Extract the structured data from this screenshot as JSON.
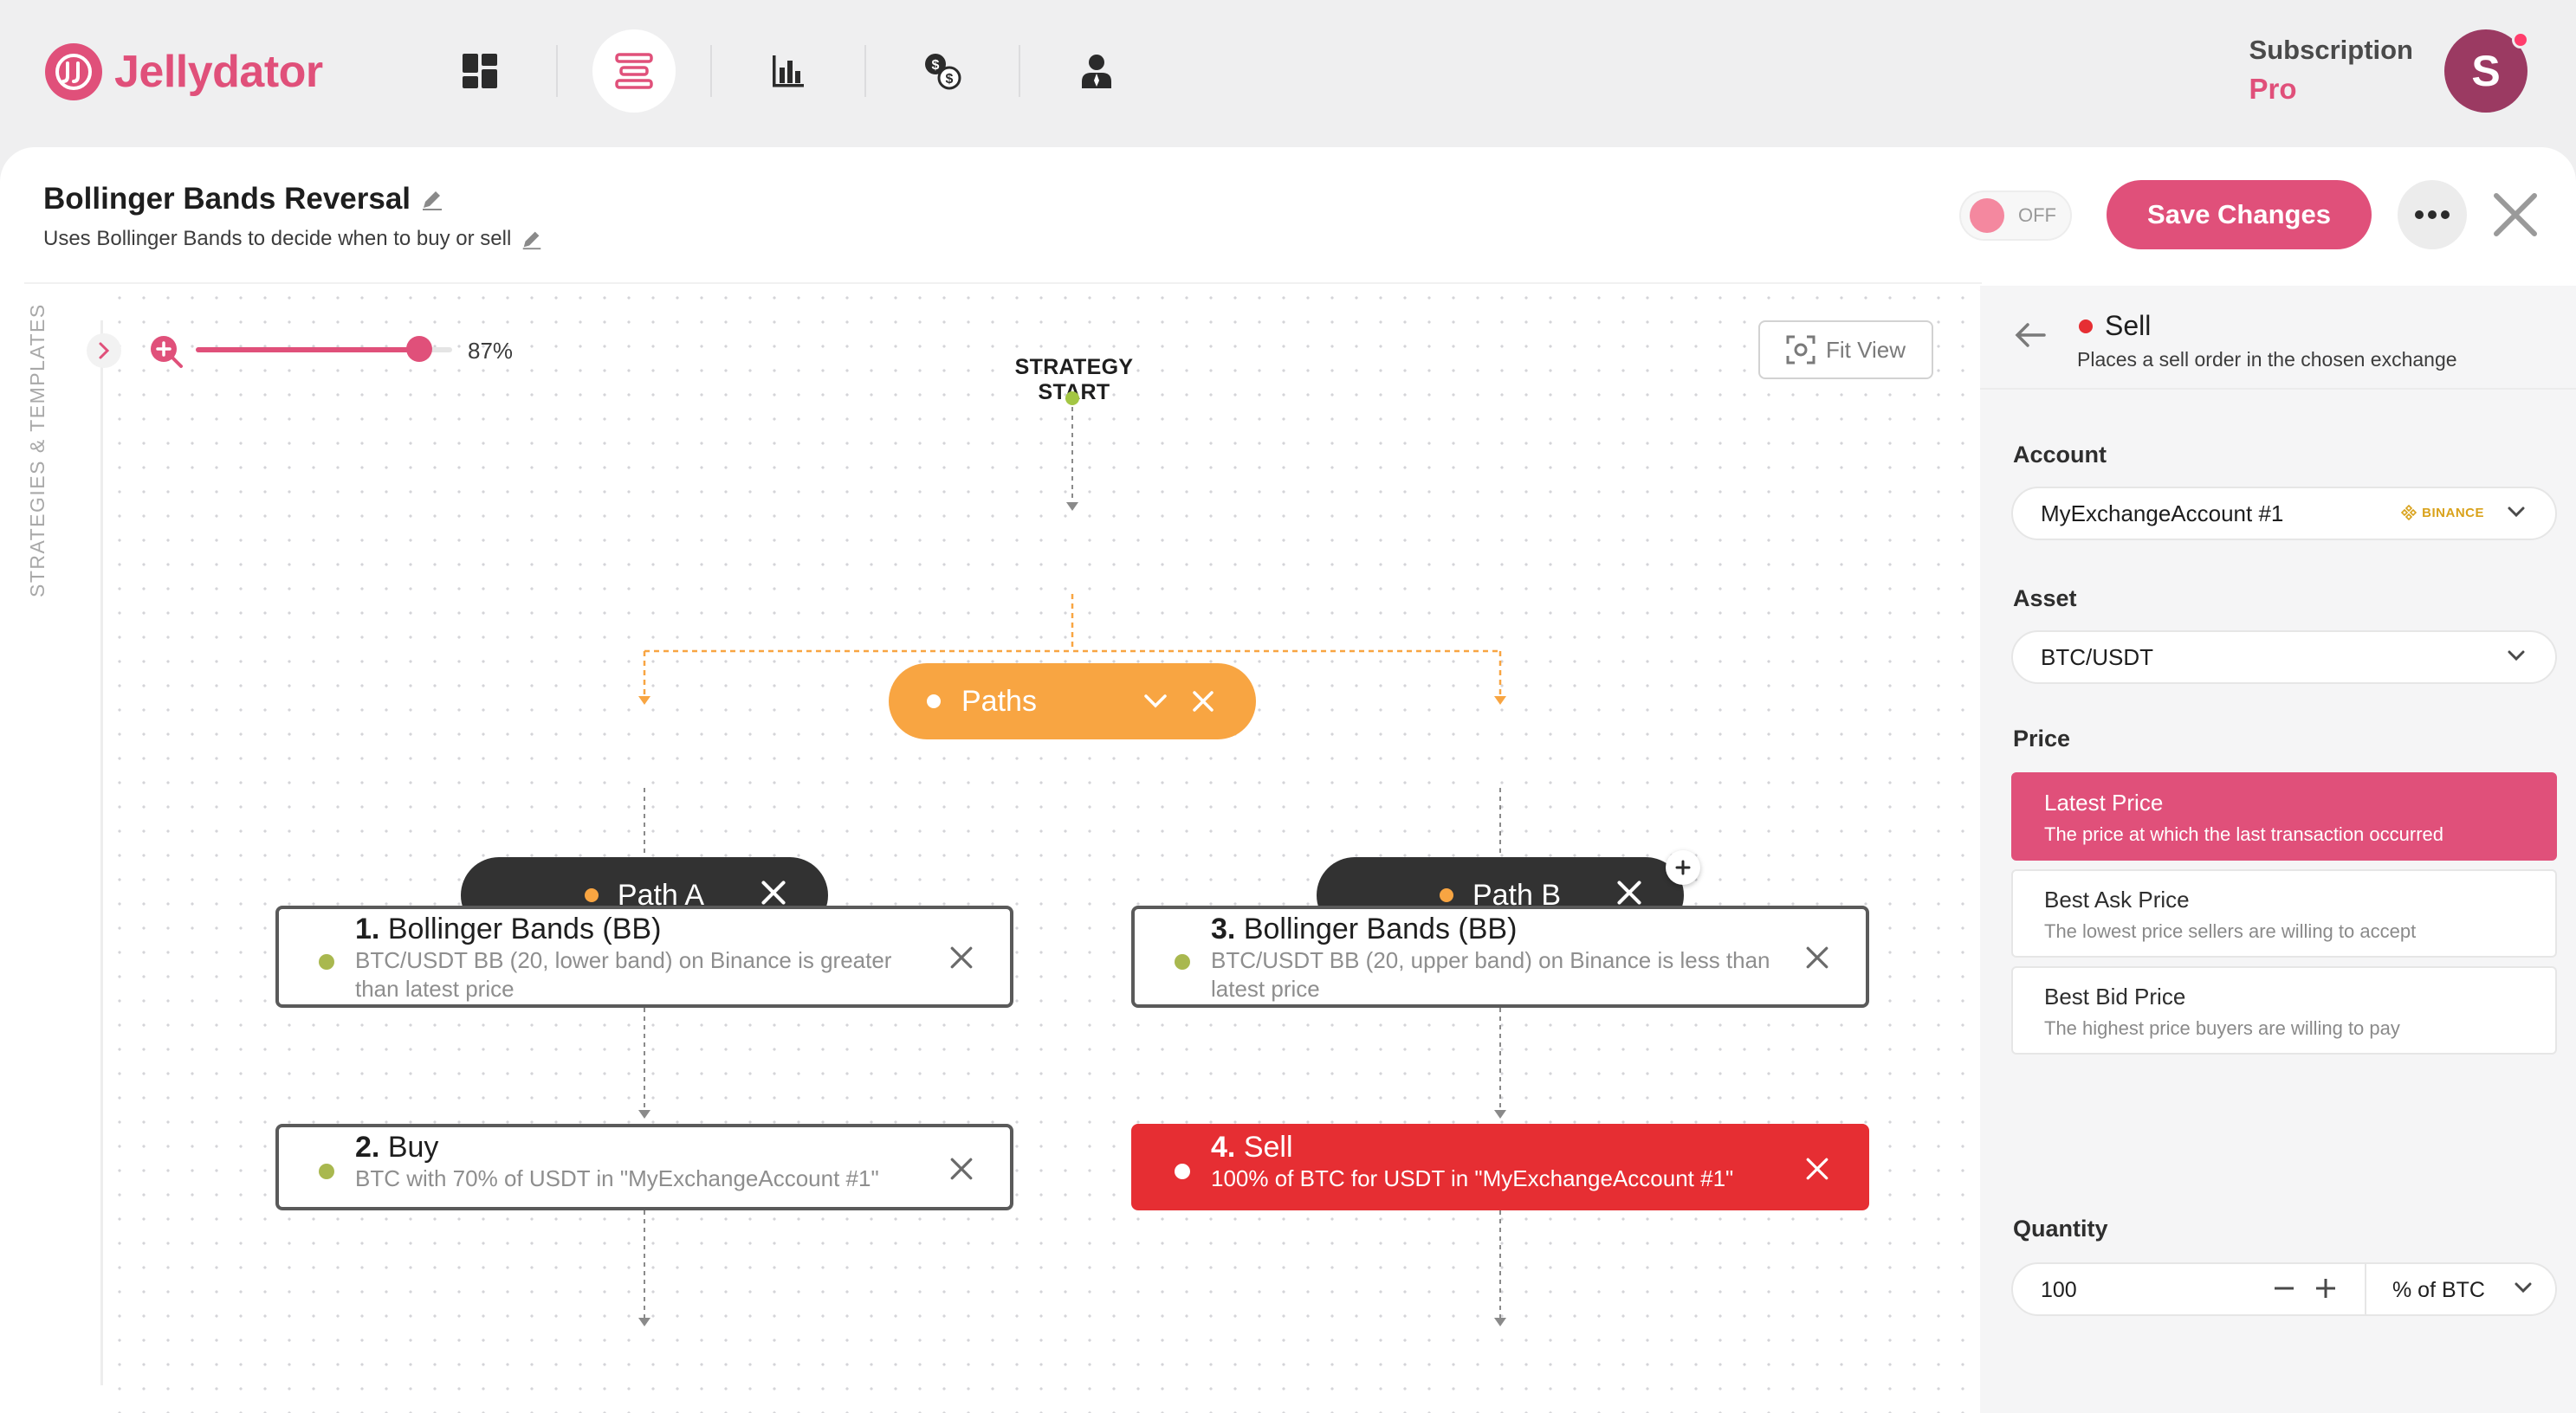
{
  "app": {
    "name": "Jellydator"
  },
  "nav": [
    "dashboard",
    "strategies",
    "charts",
    "exchange",
    "account"
  ],
  "subscription": {
    "label": "Subscription",
    "plan": "Pro"
  },
  "user": {
    "initial": "S"
  },
  "strategy": {
    "title": "Bollinger Bands Reversal",
    "description": "Uses Bollinger Bands to decide when to buy or sell",
    "toggle_label": "OFF",
    "save_label": "Save Changes"
  },
  "sidebar": {
    "label": "STRATEGIES & TEMPLATES"
  },
  "zoom": {
    "label": "87%",
    "value": 0.87
  },
  "canvas": {
    "fit_label": "Fit View",
    "start_label": "STRATEGY START",
    "paths_label": "Paths",
    "path_a": "Path A",
    "path_b": "Path B",
    "nodes": [
      {
        "num": "1.",
        "title": "Bollinger Bands (BB)",
        "desc": "BTC/USDT BB (20, lower band) on Binance is greater than latest price"
      },
      {
        "num": "2.",
        "title": "Buy",
        "desc": "BTC with 70% of USDT in \"MyExchangeAccount #1\""
      },
      {
        "num": "3.",
        "title": "Bollinger Bands (BB)",
        "desc": "BTC/USDT BB (20, upper band) on Binance is less than latest price"
      },
      {
        "num": "4.",
        "title": "Sell",
        "desc": "100% of BTC for USDT in \"MyExchangeAccount #1\""
      }
    ]
  },
  "panel": {
    "title": "Sell",
    "subtitle": "Places a sell order in the chosen exchange",
    "account_label": "Account",
    "account_value": "MyExchangeAccount #1",
    "account_badge": "BINANCE",
    "asset_label": "Asset",
    "asset_value": "BTC/USDT",
    "price_label": "Price",
    "price_options": [
      {
        "title": "Latest Price",
        "desc": "The price at which the last transaction occurred"
      },
      {
        "title": "Best Ask Price",
        "desc": "The lowest price sellers are willing to accept"
      },
      {
        "title": "Best Bid Price",
        "desc": "The highest price buyers are willing to pay"
      }
    ],
    "quantity_label": "Quantity",
    "quantity_value": "100",
    "quantity_unit": "% of BTC"
  },
  "colors": {
    "accent": "#e0507a",
    "orange": "#f8a542",
    "sell": "#e62e33",
    "dark": "#323232"
  }
}
